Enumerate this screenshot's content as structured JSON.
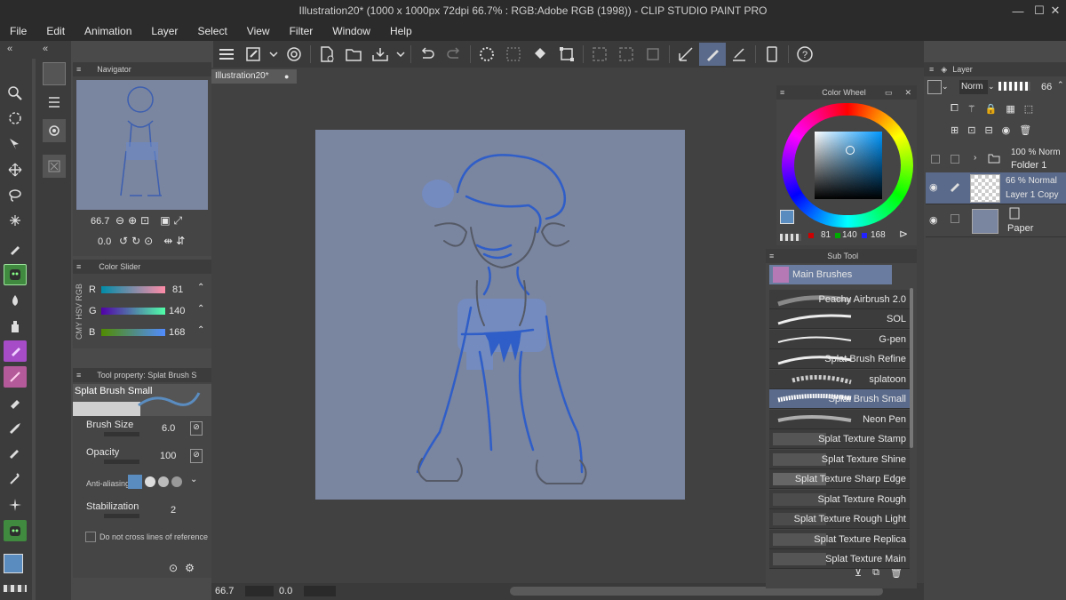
{
  "window": {
    "title": "Illustration20* (1000 x 1000px 72dpi 66.7% : RGB:Adobe RGB (1998))  - CLIP STUDIO PAINT PRO",
    "min": "—",
    "max": "☐",
    "close": "✕"
  },
  "menu": [
    "File",
    "Edit",
    "Animation",
    "Layer",
    "Select",
    "View",
    "Filter",
    "Window",
    "Help"
  ],
  "doc_tab": "Illustration20*",
  "navigator": {
    "title": "Navigator",
    "zoom": "66.7",
    "rotation": "0.0"
  },
  "color_slider": {
    "title": "Color Slider",
    "mode_tabs": "CMY HSV RGB",
    "r_label": "R",
    "g_label": "G",
    "b_label": "B",
    "r": "81",
    "g": "140",
    "b": "168"
  },
  "tool_property": {
    "title": "Tool property: Splat Brush S",
    "brush_name": "Splat Brush Small",
    "brush_size_label": "Brush Size",
    "brush_size": "6.0",
    "opacity_label": "Opacity",
    "opacity": "100",
    "antialias_label": "Anti-aliasing",
    "stabilization_label": "Stabilization",
    "stabilization": "2",
    "cross_label": "Do not cross lines of reference"
  },
  "color_wheel": {
    "title": "Color Wheel",
    "r": "81",
    "g": "140",
    "b": "168"
  },
  "sub_tool": {
    "title": "Sub Tool",
    "group": "Main Brushes",
    "items": [
      "Peachy Airbrush 2.0",
      "SOL",
      "G-pen",
      "Splat Brush Refine",
      "splatoon",
      "Splat Brush Small",
      "Neon Pen",
      "Splat Texture Stamp",
      "Splat Texture Shine",
      "Splat Texture Sharp Edge",
      "Splat Texture Rough",
      "Splat Texture Rough Light",
      "Splat Texture Replica",
      "Splat Texture Main"
    ],
    "selected": "Splat Brush Small"
  },
  "layer": {
    "title": "Layer",
    "blend": "Norm",
    "opacity": "66",
    "layers": [
      {
        "pct": "100 % Norm",
        "name": "Folder 1"
      },
      {
        "pct": "66 % Normal",
        "name": "Layer 1 Copy"
      },
      {
        "pct": "",
        "name": "Paper"
      }
    ]
  },
  "status": {
    "zoom": "66.7",
    "rotation": "0.0"
  },
  "colors": {
    "main": "#5a8cc0",
    "sub": "#f0e6c0",
    "canvas": "#7a85a0",
    "accent": "#6f7ea4"
  }
}
